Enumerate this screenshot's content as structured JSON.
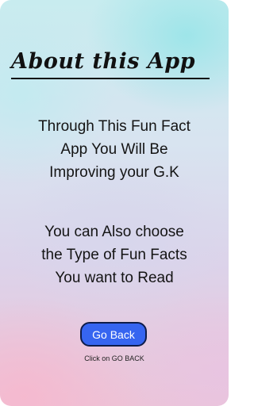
{
  "about": {
    "title": "About this App",
    "paragraph1": [
      "Through This Fun Fact",
      "App You Will Be",
      "Improving your G.K"
    ],
    "paragraph2": [
      "You can Also choose",
      "the Type of Fun Facts",
      "You want to Read"
    ]
  },
  "actions": {
    "go_back_label": "Go Back",
    "hint": "Click on GO BACK"
  },
  "colors": {
    "button": "#3665f0",
    "text": "#141414"
  }
}
